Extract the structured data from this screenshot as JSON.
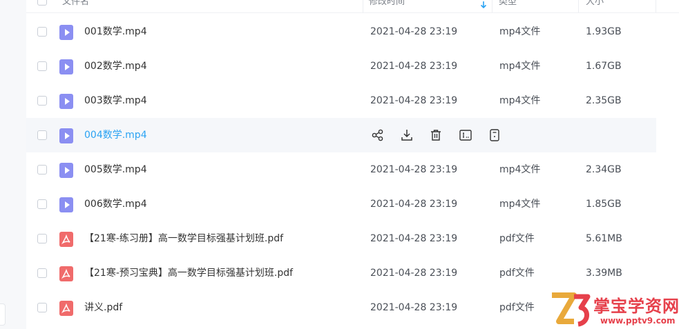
{
  "columns": {
    "name": "文件名",
    "modified": "修改时间",
    "type": "类型",
    "size": "大小"
  },
  "rows": [
    {
      "icon": "video-file-icon",
      "name": "001数学.mp4",
      "modified": "2021-04-28 23:19",
      "type": "mp4文件",
      "size": "1.93GB"
    },
    {
      "icon": "video-file-icon",
      "name": "002数学.mp4",
      "modified": "2021-04-28 23:19",
      "type": "mp4文件",
      "size": "1.67GB"
    },
    {
      "icon": "video-file-icon",
      "name": "003数学.mp4",
      "modified": "2021-04-28 23:19",
      "type": "mp4文件",
      "size": "2.35GB"
    },
    {
      "icon": "video-file-icon",
      "name": "004数学.mp4",
      "modified": "",
      "type": "",
      "size": "",
      "hovered": true
    },
    {
      "icon": "video-file-icon",
      "name": "005数学.mp4",
      "modified": "2021-04-28 23:19",
      "type": "mp4文件",
      "size": "2.34GB"
    },
    {
      "icon": "video-file-icon",
      "name": "006数学.mp4",
      "modified": "2021-04-28 23:19",
      "type": "mp4文件",
      "size": "1.85GB"
    },
    {
      "icon": "pdf-file-icon",
      "name": "【21寒-练习册】高一数学目标强基计划班.pdf",
      "modified": "2021-04-28 23:19",
      "type": "pdf文件",
      "size": "5.61MB"
    },
    {
      "icon": "pdf-file-icon",
      "name": "【21寒-预习宝典】高一数学目标强基计划班.pdf",
      "modified": "2021-04-28 23:19",
      "type": "pdf文件",
      "size": "3.39MB"
    },
    {
      "icon": "pdf-file-icon",
      "name": "讲义.pdf",
      "modified": "2021-04-28 23:19",
      "type": "pdf文件",
      "size": ""
    }
  ],
  "row_actions": [
    "share-icon",
    "download-icon",
    "delete-icon",
    "rename-icon",
    "more-icon"
  ],
  "watermark": {
    "title": "掌宝学资网",
    "url": "www.pptv9.com"
  },
  "colors": {
    "accent": "#2ba3f3",
    "video_icon": "#8b8ff2",
    "pdf_icon": "#f06b6b",
    "watermark": "#e6404b"
  }
}
